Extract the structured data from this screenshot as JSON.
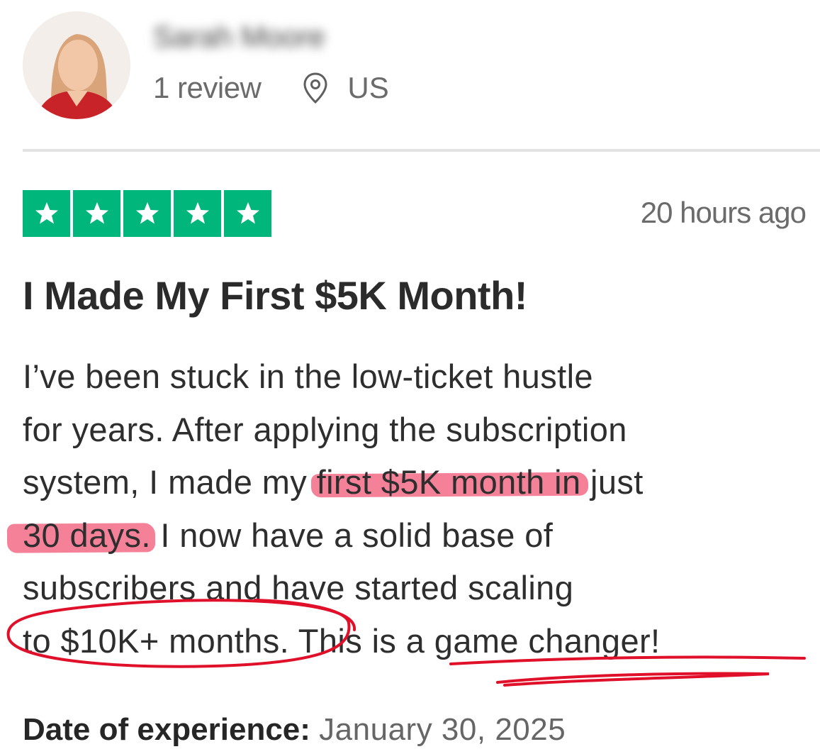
{
  "reviewer": {
    "name": "Sarah Moore",
    "review_count": "1 review",
    "country": "US"
  },
  "rating": {
    "stars": 5,
    "max": 5,
    "color": "#00b67a"
  },
  "time_ago": "20 hours ago",
  "review": {
    "title": "I Made My First $5K Month!",
    "lines": [
      [
        "I’ve been stuck in the low-ticket hustle"
      ],
      [
        "for years. After applying the subscription"
      ],
      [
        "system, I made my ",
        "first $5K month in",
        " just"
      ],
      [
        "30 days.",
        " I now have a solid base of"
      ],
      [
        "subscribers and have started scaling"
      ],
      [
        "to $10K+ months.",
        " This is a game changer!"
      ]
    ]
  },
  "experience": {
    "label": "Date of experience:",
    "date": "January 30, 2025"
  },
  "colors": {
    "highlight": "#f36b86",
    "ink_annotation": "#e0102a",
    "secondary_text": "#6b6b6b"
  },
  "icons": [
    "location-pin-icon",
    "star-icon"
  ]
}
